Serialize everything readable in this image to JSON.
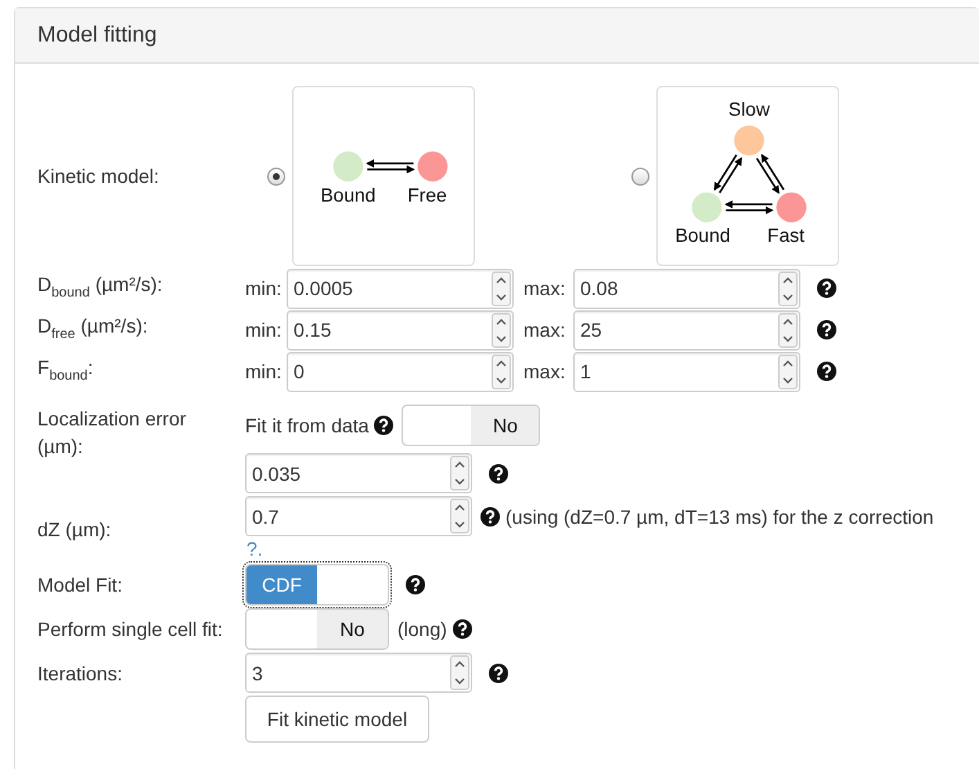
{
  "panel": {
    "title": "Model fitting"
  },
  "kinetic_model": {
    "label": "Kinetic model:",
    "options": [
      {
        "selected": true,
        "kind": "two-state",
        "nodes": [
          {
            "label": "Bound",
            "color": "#d3ebc6"
          },
          {
            "label": "Free",
            "color": "#fb9696"
          }
        ]
      },
      {
        "selected": false,
        "kind": "three-state",
        "nodes": [
          {
            "label": "Slow",
            "color": "#fdc79b"
          },
          {
            "label": "Bound",
            "color": "#d3ebc6"
          },
          {
            "label": "Fast",
            "color": "#fb9696"
          }
        ]
      }
    ]
  },
  "ranges": [
    {
      "label": "D$_{bound}$ (µm²/s):",
      "min_label": "min:",
      "min": "0.0005",
      "max_label": "max:",
      "max": "0.08"
    },
    {
      "label": "D$_{free}$ (µm²/s):",
      "min_label": "min:",
      "min": "0.15",
      "max_label": "max:",
      "max": "25"
    },
    {
      "label": "F$_{bound}$:",
      "min_label": "min:",
      "min": "0",
      "max_label": "max:",
      "max": "1"
    }
  ],
  "localization_error": {
    "label": "Localization error (µm):",
    "fit_label": "Fit it from data",
    "fit_toggle": {
      "label": "No",
      "on": false,
      "focused": false
    },
    "value": "0.035"
  },
  "dz": {
    "label": "dZ (µm):",
    "value": "0.7",
    "note": "(using (dZ=0.7 µm, dT=13 ms) for the z correction",
    "link": "?."
  },
  "model_fit": {
    "label": "Model Fit:",
    "toggle": {
      "label": "CDF",
      "on": true,
      "focused": true
    }
  },
  "single_cell_fit": {
    "label": "Perform single cell fit:",
    "toggle": {
      "label": "No",
      "on": false,
      "focused": false
    },
    "note": "(long)"
  },
  "iterations": {
    "label": "Iterations:",
    "value": "3"
  },
  "button": "Fit kinetic model"
}
